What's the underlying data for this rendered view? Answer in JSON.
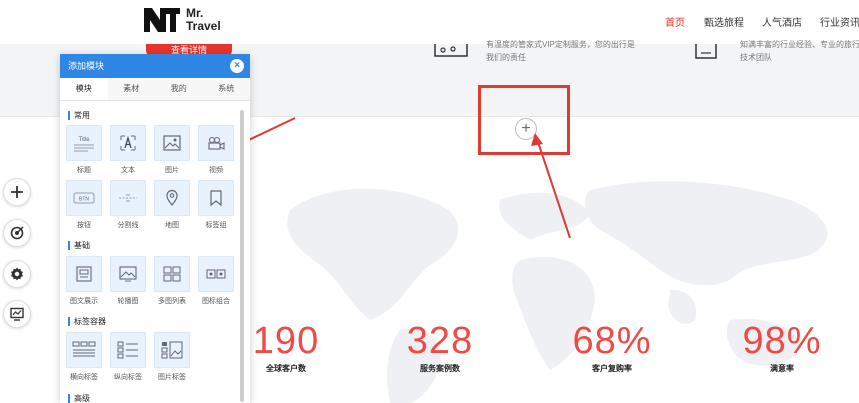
{
  "header": {
    "logo_line1": "Mr.",
    "logo_line2": "Travel",
    "nav": [
      {
        "label": "首页",
        "active": true
      },
      {
        "label": "甄选旅程",
        "active": false
      },
      {
        "label": "人气酒店",
        "active": false
      },
      {
        "label": "行业资讯",
        "active": false
      }
    ]
  },
  "hero": {
    "button_label": "查看详情",
    "feature1_line1": "有温度的管家式VIP定制服务，您的出行是",
    "feature1_line2": "我们的责任",
    "feature2_line1": "知满丰富的行业经验、专业的旅行",
    "feature2_line2": "技术团队"
  },
  "canvas": {
    "add_symbol": "+"
  },
  "stats": [
    {
      "value": "190",
      "label": "全球客户数"
    },
    {
      "value": "328",
      "label": "服务案例数"
    },
    {
      "value": "68%",
      "label": "客户复购率"
    },
    {
      "value": "98%",
      "label": "满意率"
    }
  ],
  "toolbar": {
    "icons": [
      "plus-icon",
      "target-icon",
      "gear-icon",
      "monitor-icon"
    ]
  },
  "panel": {
    "title": "添加模块",
    "close_symbol": "×",
    "tabs": [
      "模块",
      "素材",
      "我的",
      "系统"
    ],
    "sections": [
      {
        "title": "常用",
        "items": [
          "标题",
          "文本",
          "图片",
          "视频",
          "按钮",
          "分割线",
          "地图",
          "标签组"
        ]
      },
      {
        "title": "基础",
        "items": [
          "图文展示",
          "轮播图",
          "多图列表",
          "图标组合"
        ]
      },
      {
        "title": "标签容器",
        "items": [
          "横向标签",
          "纵向标签",
          "图片标签"
        ]
      },
      {
        "title": "高级",
        "items": []
      }
    ],
    "thumb_title": "Title",
    "thumb_btn": "BTN"
  },
  "colors": {
    "accent_red": "#e8342b",
    "stat_red": "#f04a47",
    "panel_blue": "#2f86e5"
  }
}
